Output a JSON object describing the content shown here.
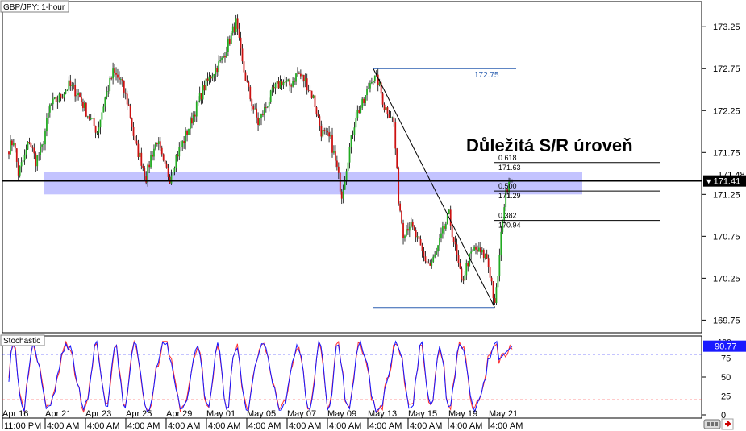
{
  "chart_data": {
    "type": "candlestick",
    "symbol_label": "GBP/JPY: 1-hour",
    "annotation_title": "Důležitá S/R úroveň",
    "price_axis": {
      "ylim": [
        169.6,
        173.55
      ],
      "ticks": [
        "173.25",
        "172.75",
        "172.25",
        "171.75",
        "171.25",
        "170.75",
        "170.25",
        "169.75"
      ],
      "tick_values": [
        173.25,
        172.75,
        172.25,
        171.75,
        171.25,
        170.75,
        170.25,
        169.75
      ],
      "current_price": 171.41,
      "current_price_label": "171.41",
      "hidden_price_label": "171.48"
    },
    "x_ticks": [
      {
        "date": "Apr 16",
        "time": "11:00 PM"
      },
      {
        "date": "Apr 21",
        "time": "4:00 AM"
      },
      {
        "date": "Apr 23",
        "time": "4:00 AM"
      },
      {
        "date": "Apr 25",
        "time": "4:00 AM"
      },
      {
        "date": "Apr 29",
        "time": "4:00 AM"
      },
      {
        "date": "May 01",
        "time": "4:00 AM"
      },
      {
        "date": "May 05",
        "time": "4:00 AM"
      },
      {
        "date": "May 07",
        "time": "4:00 AM"
      },
      {
        "date": "May 09",
        "time": "4:00 AM"
      },
      {
        "date": "May 13",
        "time": "4:00 AM"
      },
      {
        "date": "May 15",
        "time": "4:00 AM"
      },
      {
        "date": "May 19",
        "time": "4:00 AM"
      },
      {
        "date": "May 21",
        "time": "4:00 AM"
      }
    ],
    "price_anchors": [
      {
        "t": 0,
        "p": 171.8
      },
      {
        "t": 3,
        "p": 171.9
      },
      {
        "t": 6,
        "p": 171.5
      },
      {
        "t": 10,
        "p": 171.7
      },
      {
        "t": 13,
        "p": 171.9
      },
      {
        "t": 17,
        "p": 171.65
      },
      {
        "t": 21,
        "p": 171.8
      },
      {
        "t": 26,
        "p": 172.3
      },
      {
        "t": 32,
        "p": 172.4
      },
      {
        "t": 38,
        "p": 172.55
      },
      {
        "t": 44,
        "p": 172.45
      },
      {
        "t": 50,
        "p": 172.2
      },
      {
        "t": 56,
        "p": 172.0
      },
      {
        "t": 61,
        "p": 172.4
      },
      {
        "t": 66,
        "p": 172.7
      },
      {
        "t": 71,
        "p": 172.6
      },
      {
        "t": 76,
        "p": 172.3
      },
      {
        "t": 80,
        "p": 171.85
      },
      {
        "t": 84,
        "p": 171.65
      },
      {
        "t": 87,
        "p": 171.45
      },
      {
        "t": 90,
        "p": 171.7
      },
      {
        "t": 94,
        "p": 171.9
      },
      {
        "t": 98,
        "p": 171.6
      },
      {
        "t": 102,
        "p": 171.45
      },
      {
        "t": 106,
        "p": 171.7
      },
      {
        "t": 111,
        "p": 171.9
      },
      {
        "t": 117,
        "p": 172.2
      },
      {
        "t": 123,
        "p": 172.5
      },
      {
        "t": 129,
        "p": 172.7
      },
      {
        "t": 135,
        "p": 172.85
      },
      {
        "t": 140,
        "p": 173.1
      },
      {
        "t": 144,
        "p": 173.3
      },
      {
        "t": 148,
        "p": 172.8
      },
      {
        "t": 153,
        "p": 172.4
      },
      {
        "t": 158,
        "p": 172.1
      },
      {
        "t": 163,
        "p": 172.3
      },
      {
        "t": 168,
        "p": 172.5
      },
      {
        "t": 173,
        "p": 172.6
      },
      {
        "t": 178,
        "p": 172.55
      },
      {
        "t": 183,
        "p": 172.7
      },
      {
        "t": 188,
        "p": 172.6
      },
      {
        "t": 193,
        "p": 172.4
      },
      {
        "t": 198,
        "p": 172.0
      },
      {
        "t": 204,
        "p": 171.9
      },
      {
        "t": 208,
        "p": 171.55
      },
      {
        "t": 211,
        "p": 171.25
      },
      {
        "t": 215,
        "p": 171.7
      },
      {
        "t": 220,
        "p": 172.2
      },
      {
        "t": 225,
        "p": 172.35
      },
      {
        "t": 230,
        "p": 172.65
      },
      {
        "t": 234,
        "p": 172.6
      },
      {
        "t": 238,
        "p": 172.3
      },
      {
        "t": 242,
        "p": 172.2
      },
      {
        "t": 244,
        "p": 172.1
      },
      {
        "t": 247,
        "p": 171.2
      },
      {
        "t": 250,
        "p": 170.8
      },
      {
        "t": 254,
        "p": 170.9
      },
      {
        "t": 258,
        "p": 170.75
      },
      {
        "t": 263,
        "p": 170.5
      },
      {
        "t": 267,
        "p": 170.4
      },
      {
        "t": 271,
        "p": 170.55
      },
      {
        "t": 275,
        "p": 170.8
      },
      {
        "t": 279,
        "p": 171.0
      },
      {
        "t": 283,
        "p": 170.6
      },
      {
        "t": 287,
        "p": 170.2
      },
      {
        "t": 291,
        "p": 170.45
      },
      {
        "t": 295,
        "p": 170.6
      },
      {
        "t": 299,
        "p": 170.55
      },
      {
        "t": 303,
        "p": 170.5
      },
      {
        "t": 306,
        "p": 170.2
      },
      {
        "t": 308,
        "p": 169.9
      },
      {
        "t": 311,
        "p": 170.5
      },
      {
        "t": 313,
        "p": 171.0
      },
      {
        "t": 315,
        "p": 171.25
      },
      {
        "t": 317,
        "p": 171.45
      },
      {
        "t": 319,
        "p": 171.41
      }
    ],
    "bar_count": 320,
    "sr_zone": {
      "low": 171.25,
      "high": 171.52
    },
    "fibonacci": {
      "swing_high": 172.75,
      "swing_low": 169.9,
      "high_label": "172.75",
      "levels": [
        {
          "ratio": "0.618",
          "value": "171.63",
          "price": 171.63
        },
        {
          "ratio": "0.500",
          "value": "171.29",
          "price": 171.29
        },
        {
          "ratio": "0.382",
          "value": "170.94",
          "price": 170.94
        }
      ]
    },
    "stochastic": {
      "label": "Stochastic",
      "ylim": [
        0,
        100
      ],
      "ticks": [
        "100",
        "75",
        "50",
        "25",
        "0"
      ],
      "tick_values": [
        100,
        75,
        50,
        25,
        0
      ],
      "levels": [
        80,
        20
      ],
      "current_label": "90.77",
      "current_value": 90.77,
      "colors": {
        "k": "#1515ff",
        "d": "#ff3030"
      }
    },
    "colors": {
      "bull": "#22aa22",
      "bear": "#cc1111",
      "zone": "#aaaaff",
      "fib": "#2b5fb0",
      "axis": "#000000"
    }
  }
}
